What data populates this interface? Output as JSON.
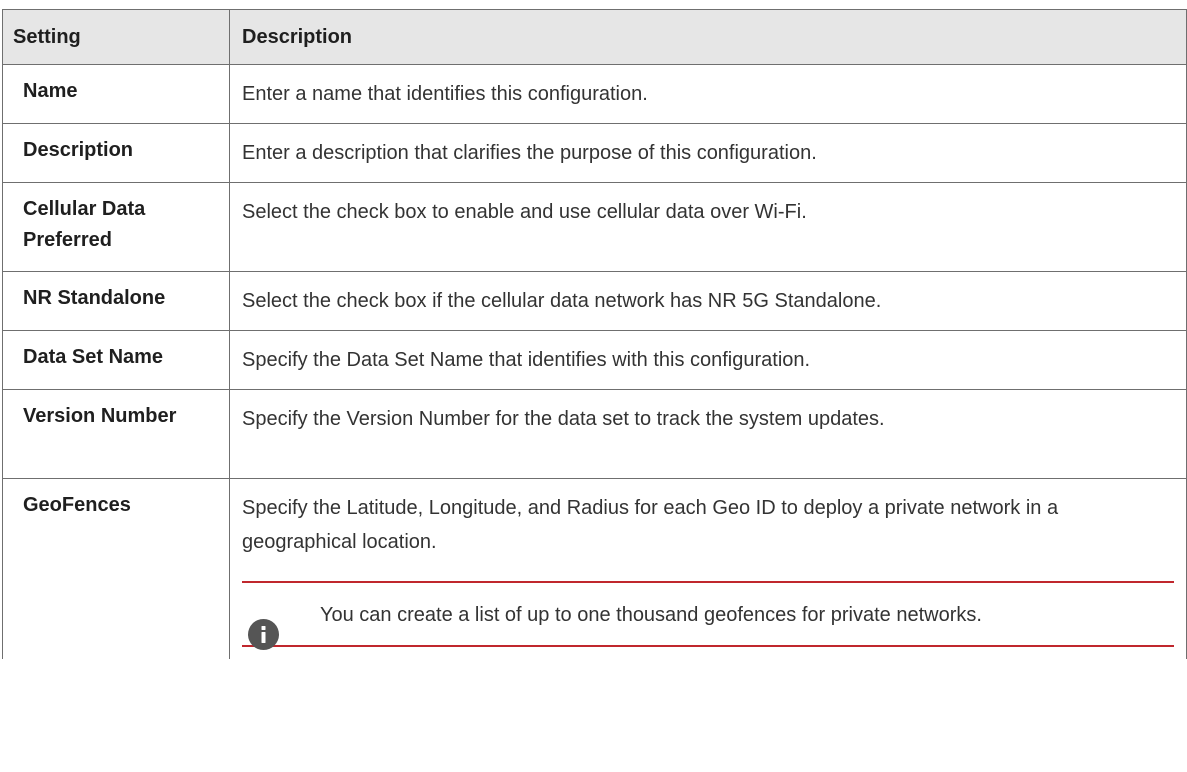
{
  "table": {
    "headers": {
      "setting": "Setting",
      "description": "Description"
    },
    "rows": [
      {
        "setting": "Name",
        "description": "Enter a name that identifies this configuration."
      },
      {
        "setting": "Description",
        "description": "Enter a description that clarifies the purpose of this configuration."
      },
      {
        "setting": "Cellular Data Preferred",
        "description": "Select the check box to enable and use cellular data over Wi-Fi."
      },
      {
        "setting": "NR Standalone",
        "description": "Select the check box if the cellular data network has NR 5G Standalone."
      },
      {
        "setting": "Data Set Name",
        "description": "Specify the Data Set Name that identifies with this configuration."
      },
      {
        "setting": "Version Number",
        "description": "Specify the Version Number for the data set to track the system updates."
      },
      {
        "setting": "GeoFences",
        "description": "Specify the Latitude, Longitude, and Radius for each Geo ID to deploy a private network in a geographical location.",
        "note": {
          "icon": "info-icon",
          "text": "You can create a list of up to one thousand geofences for private networks."
        }
      }
    ]
  },
  "colors": {
    "header_bg": "#e6e6e6",
    "border": "#6f6f6f",
    "note_rule": "#c0272d",
    "icon_bg": "#555555"
  }
}
